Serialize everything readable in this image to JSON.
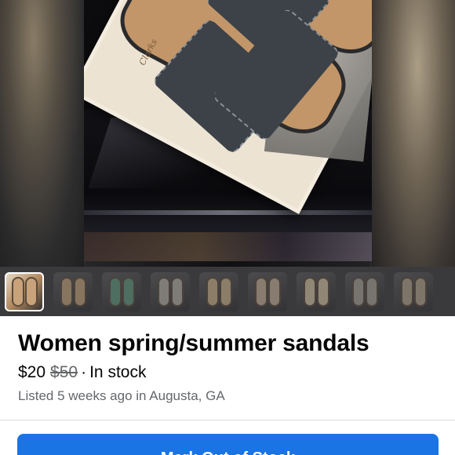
{
  "listing": {
    "title": "Women spring/summer sandals",
    "price": "$20",
    "original_price": "$50",
    "separator": "·",
    "stock_status": "In stock",
    "listed_info": "Listed 5 weeks ago in Augusta, GA"
  },
  "gallery": {
    "main_photo_icon": "sandals-in-box-photo",
    "thumbnail_count": 9,
    "active_index": 0,
    "thumbnail_tints": [
      "#c7a27a",
      "#c9a67c",
      "#5f9a82",
      "#b8b3a8",
      "#d0b48e",
      "#c7b39a",
      "#d9c6a6",
      "#a9a497",
      "#b4a88c"
    ],
    "brand_mark": "Clarks"
  },
  "actions": {
    "mark_out_of_stock_label": "Mark Out of Stock"
  },
  "colors": {
    "accent": "#1b74e4",
    "text_primary": "#050505",
    "text_secondary": "#65676b"
  }
}
